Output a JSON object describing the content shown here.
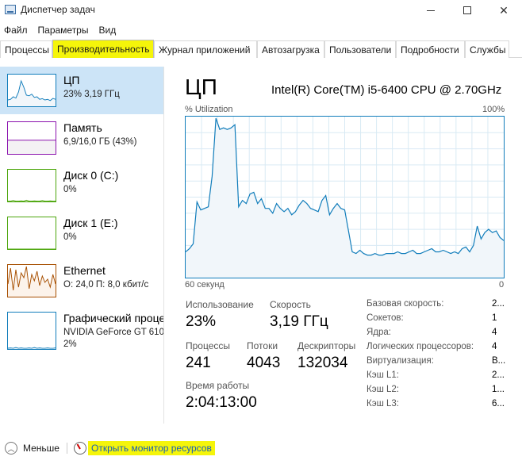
{
  "window": {
    "title": "Диспетчер задач",
    "icon": "task-manager-icon"
  },
  "menu": [
    "Файл",
    "Параметры",
    "Вид"
  ],
  "tabs": [
    {
      "label": "Процессы",
      "active": false
    },
    {
      "label": "Производительность",
      "active": true
    },
    {
      "label": "Журнал приложений",
      "active": false
    },
    {
      "label": "Автозагрузка",
      "active": false
    },
    {
      "label": "Пользователи",
      "active": false
    },
    {
      "label": "Подробности",
      "active": false
    },
    {
      "label": "Службы",
      "active": false
    }
  ],
  "resources": [
    {
      "title": "ЦП",
      "sub": "23% 3,19 ГГц",
      "sub2": "",
      "color": "#117dbb",
      "fill": "#f1f6fa",
      "selected": true,
      "spark": [
        20,
        22,
        30,
        26,
        45,
        80,
        60,
        35,
        33,
        38,
        28,
        30,
        22,
        24,
        20,
        22,
        18,
        25,
        22
      ]
    },
    {
      "title": "Память",
      "sub": "6,9/16,0 ГБ (43%)",
      "sub2": "",
      "color": "#8b12ae",
      "fill": "#f4f2f4",
      "selected": false,
      "spark": [
        43,
        43,
        43,
        43,
        43,
        43,
        43,
        43,
        43,
        43,
        43,
        43,
        43,
        43,
        43,
        43,
        43,
        43,
        43
      ]
    },
    {
      "title": "Диск 0 (C:)",
      "sub": "0%",
      "sub2": "",
      "color": "#4da60c",
      "fill": "#eff4e8",
      "selected": false,
      "spark": [
        1,
        1,
        3,
        1,
        1,
        2,
        1,
        4,
        1,
        1,
        2,
        1,
        1,
        3,
        1,
        1,
        2,
        1,
        1
      ]
    },
    {
      "title": "Диск 1 (E:)",
      "sub": "0%",
      "sub2": "",
      "color": "#4da60c",
      "fill": "#eff4e8",
      "selected": false,
      "spark": [
        0,
        0,
        0,
        0,
        0,
        0,
        0,
        0,
        0,
        0,
        0,
        0,
        0,
        0,
        0,
        0,
        0,
        0,
        0
      ]
    },
    {
      "title": "Ethernet",
      "sub": "О: 24,0 П: 8,0 кбит/с",
      "sub2": "",
      "color": "#a74f01",
      "fill": "#fcf3eb",
      "selected": false,
      "spark": [
        40,
        90,
        20,
        85,
        30,
        75,
        60,
        95,
        25,
        70,
        50,
        80,
        35,
        65,
        45,
        55,
        30,
        70,
        40
      ]
    },
    {
      "title": "Графический процессор",
      "sub": "NVIDIA GeForce GT 610",
      "sub2": "2%",
      "color": "#117dbb",
      "fill": "#f1f6fa",
      "selected": false,
      "spark": [
        2,
        3,
        2,
        4,
        2,
        3,
        2,
        2,
        3,
        2,
        4,
        2,
        3,
        2,
        2,
        3,
        2,
        2,
        3
      ]
    }
  ],
  "main": {
    "title": "ЦП",
    "model": "Intel(R) Core(TM) i5-6400 CPU @ 2.70GHz",
    "util_label": "% Utilization",
    "util_max": "100%",
    "axis_left": "60 секунд",
    "axis_right": "0",
    "line_color": "#117dbb",
    "fill_color": "#f1f6fa",
    "grid_color": "#d9eaf4",
    "chart_data": {
      "type": "area",
      "xlabel": "60 секунд",
      "ylabel": "% Utilization",
      "xlim": [
        60,
        0
      ],
      "ylim": [
        0,
        100
      ],
      "series": [
        {
          "values": [
            16,
            18,
            21,
            47,
            42,
            43,
            44,
            63,
            99,
            92,
            93,
            92,
            93,
            95,
            44,
            48,
            46,
            52,
            53,
            46,
            49,
            43,
            43,
            40,
            46,
            43,
            41,
            43,
            39,
            41,
            45,
            48,
            46,
            43,
            42,
            41,
            48,
            51,
            39,
            43,
            46,
            43,
            42,
            29,
            16,
            15,
            17,
            15,
            14,
            14,
            15,
            14,
            14,
            15,
            15,
            15,
            16,
            15,
            15,
            16,
            17,
            15,
            15,
            16,
            17,
            18,
            16,
            16,
            17,
            16,
            15,
            16,
            15,
            18,
            19,
            16,
            20,
            32,
            24,
            28,
            30,
            28,
            29,
            25,
            23
          ]
        }
      ]
    }
  },
  "stats": {
    "usage_label": "Использование",
    "usage_value": "23%",
    "speed_label": "Скорость",
    "speed_value": "3,19 ГГц",
    "processes_label": "Процессы",
    "processes_value": "241",
    "threads_label": "Потоки",
    "threads_value": "4043",
    "handles_label": "Дескрипторы",
    "handles_value": "132034",
    "uptime_label": "Время работы",
    "uptime_value": "2:04:13:00"
  },
  "details": [
    {
      "label": "Базовая скорость:",
      "value": "2..."
    },
    {
      "label": "Сокетов:",
      "value": "1"
    },
    {
      "label": "Ядра:",
      "value": "4"
    },
    {
      "label": "Логических процессоров:",
      "value": "4"
    },
    {
      "label": "Виртуализация:",
      "value": "В..."
    },
    {
      "label": "Кэш L1:",
      "value": "2..."
    },
    {
      "label": "Кэш L2:",
      "value": "1..."
    },
    {
      "label": "Кэш L3:",
      "value": "6..."
    }
  ],
  "footer": {
    "less_label": "Меньше",
    "monitor_label": "Открыть монитор ресурсов"
  }
}
